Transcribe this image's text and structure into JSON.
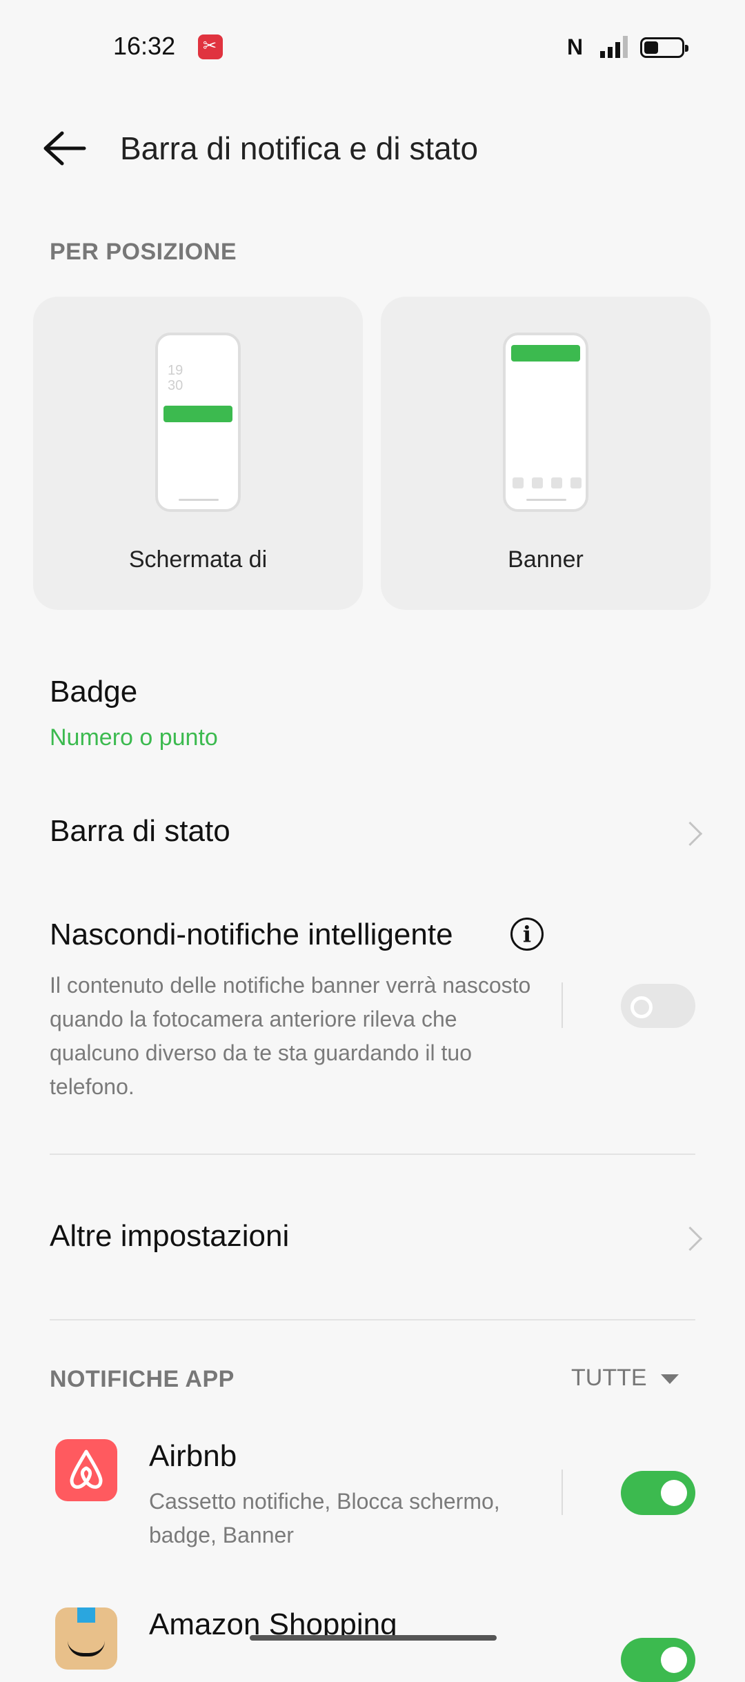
{
  "status_bar": {
    "time": "16:32",
    "nfc": "N"
  },
  "header": {
    "title": "Barra di notifica e di stato"
  },
  "position_section": {
    "label": "PER POSIZIONE",
    "cards": [
      {
        "label": "Schermata di",
        "preview_time": "19\n30"
      },
      {
        "label": "Banner"
      }
    ]
  },
  "badge": {
    "title": "Badge",
    "value": "Numero o punto"
  },
  "status_bar_row": {
    "title": "Barra di stato"
  },
  "smart_hide": {
    "title": "Nascondi-notifiche intelligente",
    "info_glyph": "i",
    "description": "Il contenuto delle notifiche banner verrà nascosto quando la fotocamera anteriore rileva che qualcuno diverso da te sta guardando il tuo telefono.",
    "enabled": false
  },
  "other_settings": {
    "title": "Altre impostazioni"
  },
  "app_notifications": {
    "label": "NOTIFICHE APP",
    "filter": "TUTTE",
    "apps": [
      {
        "name": "Airbnb",
        "detail": "Cassetto notifiche, Blocca schermo, badge, Banner",
        "enabled": true
      },
      {
        "name": "Amazon Shopping",
        "enabled": true
      }
    ]
  },
  "colors": {
    "accent": "#3cba4f",
    "background": "#f7f7f7"
  }
}
